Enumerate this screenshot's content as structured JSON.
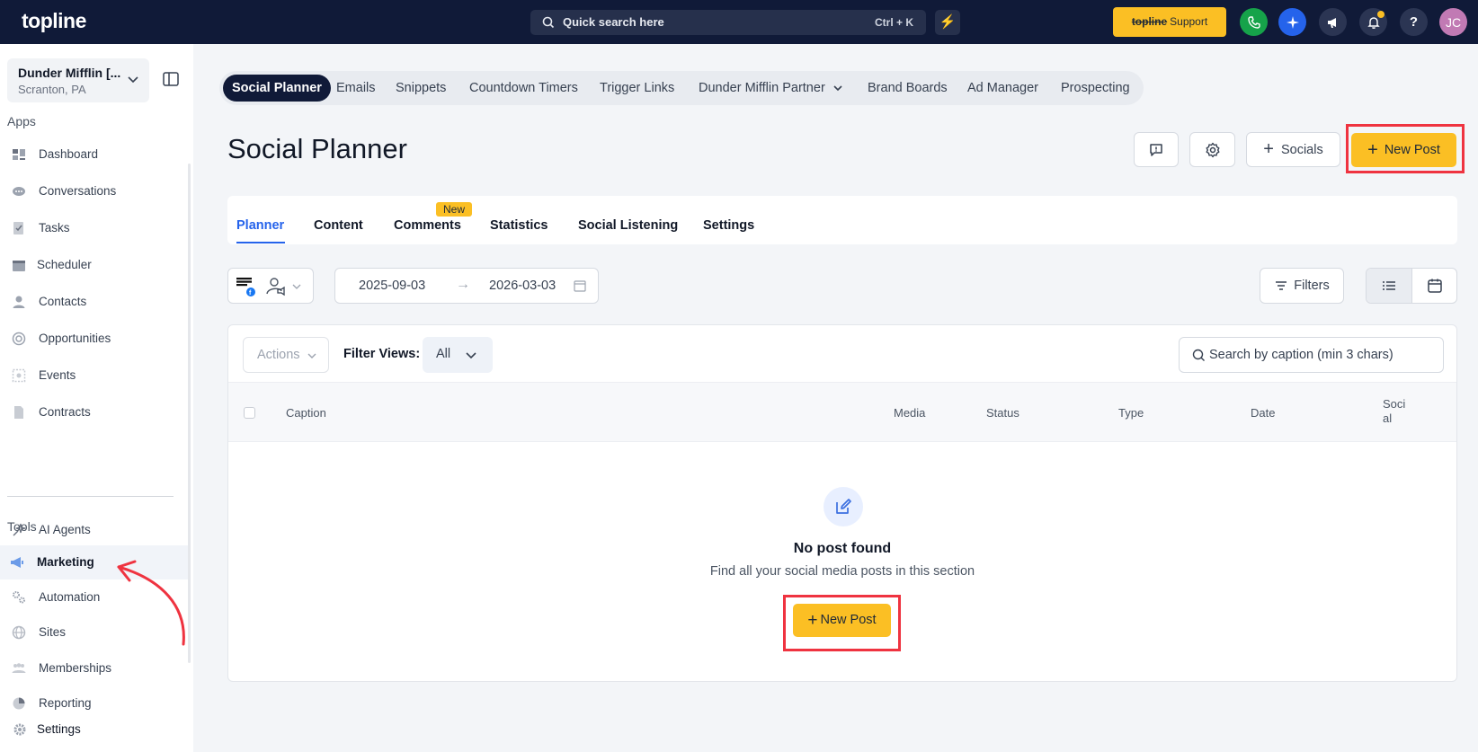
{
  "topbar": {
    "logo": "topline",
    "search_label": "Quick search here",
    "search_shortcut": "Ctrl + K",
    "support_brand": "topline",
    "support_label": "Support",
    "avatar_initials": "JC",
    "help_label": "?"
  },
  "sidebar": {
    "location_name": "Dunder Mifflin [...",
    "location_sub": "Scranton, PA",
    "apps_heading": "Apps",
    "tools_heading": "Tools",
    "apps": [
      {
        "label": "Dashboard",
        "icon": "dashboard-icon"
      },
      {
        "label": "Conversations",
        "icon": "chat-icon"
      },
      {
        "label": "Tasks",
        "icon": "tasks-icon"
      },
      {
        "label": "Scheduler",
        "icon": "calendar-icon"
      },
      {
        "label": "Contacts",
        "icon": "person-icon"
      },
      {
        "label": "Opportunities",
        "icon": "target-icon"
      },
      {
        "label": "Events",
        "icon": "events-icon"
      },
      {
        "label": "Contracts",
        "icon": "document-icon"
      }
    ],
    "ai_agents": "AI Agents",
    "tools": [
      {
        "label": "Marketing",
        "icon": "megaphone-icon",
        "active": true
      },
      {
        "label": "Automation",
        "icon": "gears-icon"
      },
      {
        "label": "Sites",
        "icon": "globe-icon"
      },
      {
        "label": "Memberships",
        "icon": "group-icon"
      },
      {
        "label": "Reporting",
        "icon": "pie-chart-icon"
      }
    ],
    "settings": "Settings"
  },
  "navtabs": [
    {
      "label": "Social Planner",
      "active": true
    },
    {
      "label": "Emails"
    },
    {
      "label": "Snippets"
    },
    {
      "label": "Countdown Timers"
    },
    {
      "label": "Trigger Links"
    },
    {
      "label": "Dunder Mifflin Partner"
    },
    {
      "label": "Brand Boards"
    },
    {
      "label": "Ad Manager"
    },
    {
      "label": "Prospecting"
    }
  ],
  "page": {
    "title": "Social Planner",
    "socials_label": "Socials",
    "new_post_label": "New Post"
  },
  "subtabs": [
    {
      "label": "Planner",
      "active": true
    },
    {
      "label": "Content"
    },
    {
      "label": "Comments",
      "badge": "New"
    },
    {
      "label": "Statistics"
    },
    {
      "label": "Social Listening"
    },
    {
      "label": "Settings"
    }
  ],
  "filters": {
    "date_from": "2025-09-03",
    "date_to": "2026-03-03",
    "filters_label": "Filters"
  },
  "table": {
    "actions_label": "Actions",
    "filter_views_label": "Filter Views:",
    "filter_views_value": "All",
    "search_placeholder": "Search by caption (min 3 chars)",
    "columns": [
      "Caption",
      "Media",
      "Status",
      "Type",
      "Date",
      "Social"
    ],
    "empty_title": "No post found",
    "empty_sub": "Find all your social media posts in this section",
    "empty_button": "New Post"
  },
  "colors": {
    "topbar_bg": "#101a38",
    "accent_yellow": "#fbbf24",
    "link_blue": "#2563eb",
    "highlight_red": "#ef3340"
  }
}
